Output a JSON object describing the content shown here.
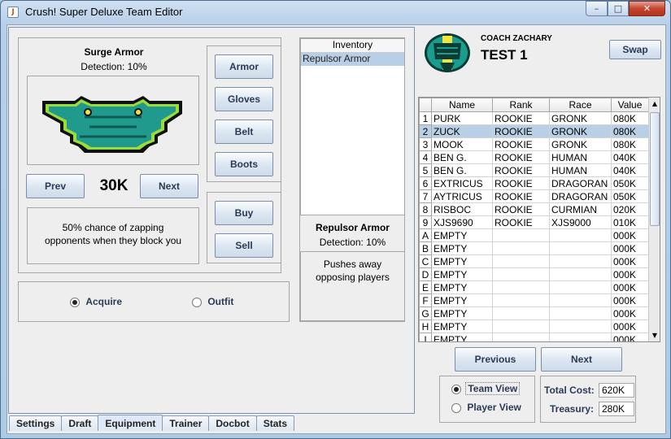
{
  "window": {
    "title": "Crush! Super Deluxe Team Editor",
    "min": "–",
    "max": "□",
    "close": "✕"
  },
  "item": {
    "name": "Surge Armor",
    "detection": "Detection: 10%",
    "price": "30K",
    "description_line1": "50% chance of zapping",
    "description_line2": "opponents when they block you",
    "prev": "Prev",
    "next": "Next"
  },
  "categories": [
    "Armor",
    "Gloves",
    "Belt",
    "Boots"
  ],
  "trade": {
    "buy": "Buy",
    "sell": "Sell"
  },
  "mode": {
    "acquire": "Acquire",
    "outfit": "Outfit",
    "selected": "Acquire"
  },
  "inventory": {
    "header": "Inventory",
    "items": [
      "Repulsor Armor"
    ],
    "selected": {
      "name": "Repulsor Armor",
      "detection": "Detection: 10%",
      "description_line1": "Pushes away",
      "description_line2": "opposing players"
    }
  },
  "tabs": [
    "Settings",
    "Draft",
    "Equipment",
    "Trainer",
    "Docbot",
    "Stats"
  ],
  "active_tab": "Equipment",
  "team": {
    "coach": "COACH ZACHARY",
    "name": "TEST 1",
    "swap": "Swap",
    "colors": {
      "helmet": "#1a9c8e",
      "trim": "#f0e640",
      "dark": "#0b3d36"
    }
  },
  "roster": {
    "columns": [
      "Name",
      "Rank",
      "Race",
      "Value"
    ],
    "selected_row": 1,
    "rows": [
      {
        "idx": "1",
        "name": "PURK",
        "rank": "ROOKIE",
        "race": "GRONK",
        "value": "080K"
      },
      {
        "idx": "2",
        "name": "ZUCK",
        "rank": "ROOKIE",
        "race": "GRONK",
        "value": "080K"
      },
      {
        "idx": "3",
        "name": "MOOK",
        "rank": "ROOKIE",
        "race": "GRONK",
        "value": "080K"
      },
      {
        "idx": "4",
        "name": "BEN G.",
        "rank": "ROOKIE",
        "race": "HUMAN",
        "value": "040K"
      },
      {
        "idx": "5",
        "name": "BEN G.",
        "rank": "ROOKIE",
        "race": "HUMAN",
        "value": "040K"
      },
      {
        "idx": "6",
        "name": "EXTRICUS",
        "rank": "ROOKIE",
        "race": "DRAGORAN",
        "value": "050K"
      },
      {
        "idx": "7",
        "name": "AYTRICUS",
        "rank": "ROOKIE",
        "race": "DRAGORAN",
        "value": "050K"
      },
      {
        "idx": "8",
        "name": "RISBOC",
        "rank": "ROOKIE",
        "race": "CURMIAN",
        "value": "020K"
      },
      {
        "idx": "9",
        "name": "XJS9690",
        "rank": "ROOKIE",
        "race": "XJS9000",
        "value": "010K"
      },
      {
        "idx": "A",
        "name": "EMPTY",
        "rank": "",
        "race": "",
        "value": "000K"
      },
      {
        "idx": "B",
        "name": "EMPTY",
        "rank": "",
        "race": "",
        "value": "000K"
      },
      {
        "idx": "C",
        "name": "EMPTY",
        "rank": "",
        "race": "",
        "value": "000K"
      },
      {
        "idx": "D",
        "name": "EMPTY",
        "rank": "",
        "race": "",
        "value": "000K"
      },
      {
        "idx": "E",
        "name": "EMPTY",
        "rank": "",
        "race": "",
        "value": "000K"
      },
      {
        "idx": "F",
        "name": "EMPTY",
        "rank": "",
        "race": "",
        "value": "000K"
      },
      {
        "idx": "G",
        "name": "EMPTY",
        "rank": "",
        "race": "",
        "value": "000K"
      },
      {
        "idx": "H",
        "name": "EMPTY",
        "rank": "",
        "race": "",
        "value": "000K"
      },
      {
        "idx": "I",
        "name": "EMPTY",
        "rank": "",
        "race": "",
        "value": "000K"
      }
    ]
  },
  "nav": {
    "previous": "Previous",
    "next": "Next"
  },
  "view": {
    "team": "Team View",
    "player": "Player View",
    "selected": "Team View"
  },
  "totals": {
    "cost_label": "Total Cost:",
    "cost": "620K",
    "treasury_label": "Treasury:",
    "treasury": "280K"
  }
}
